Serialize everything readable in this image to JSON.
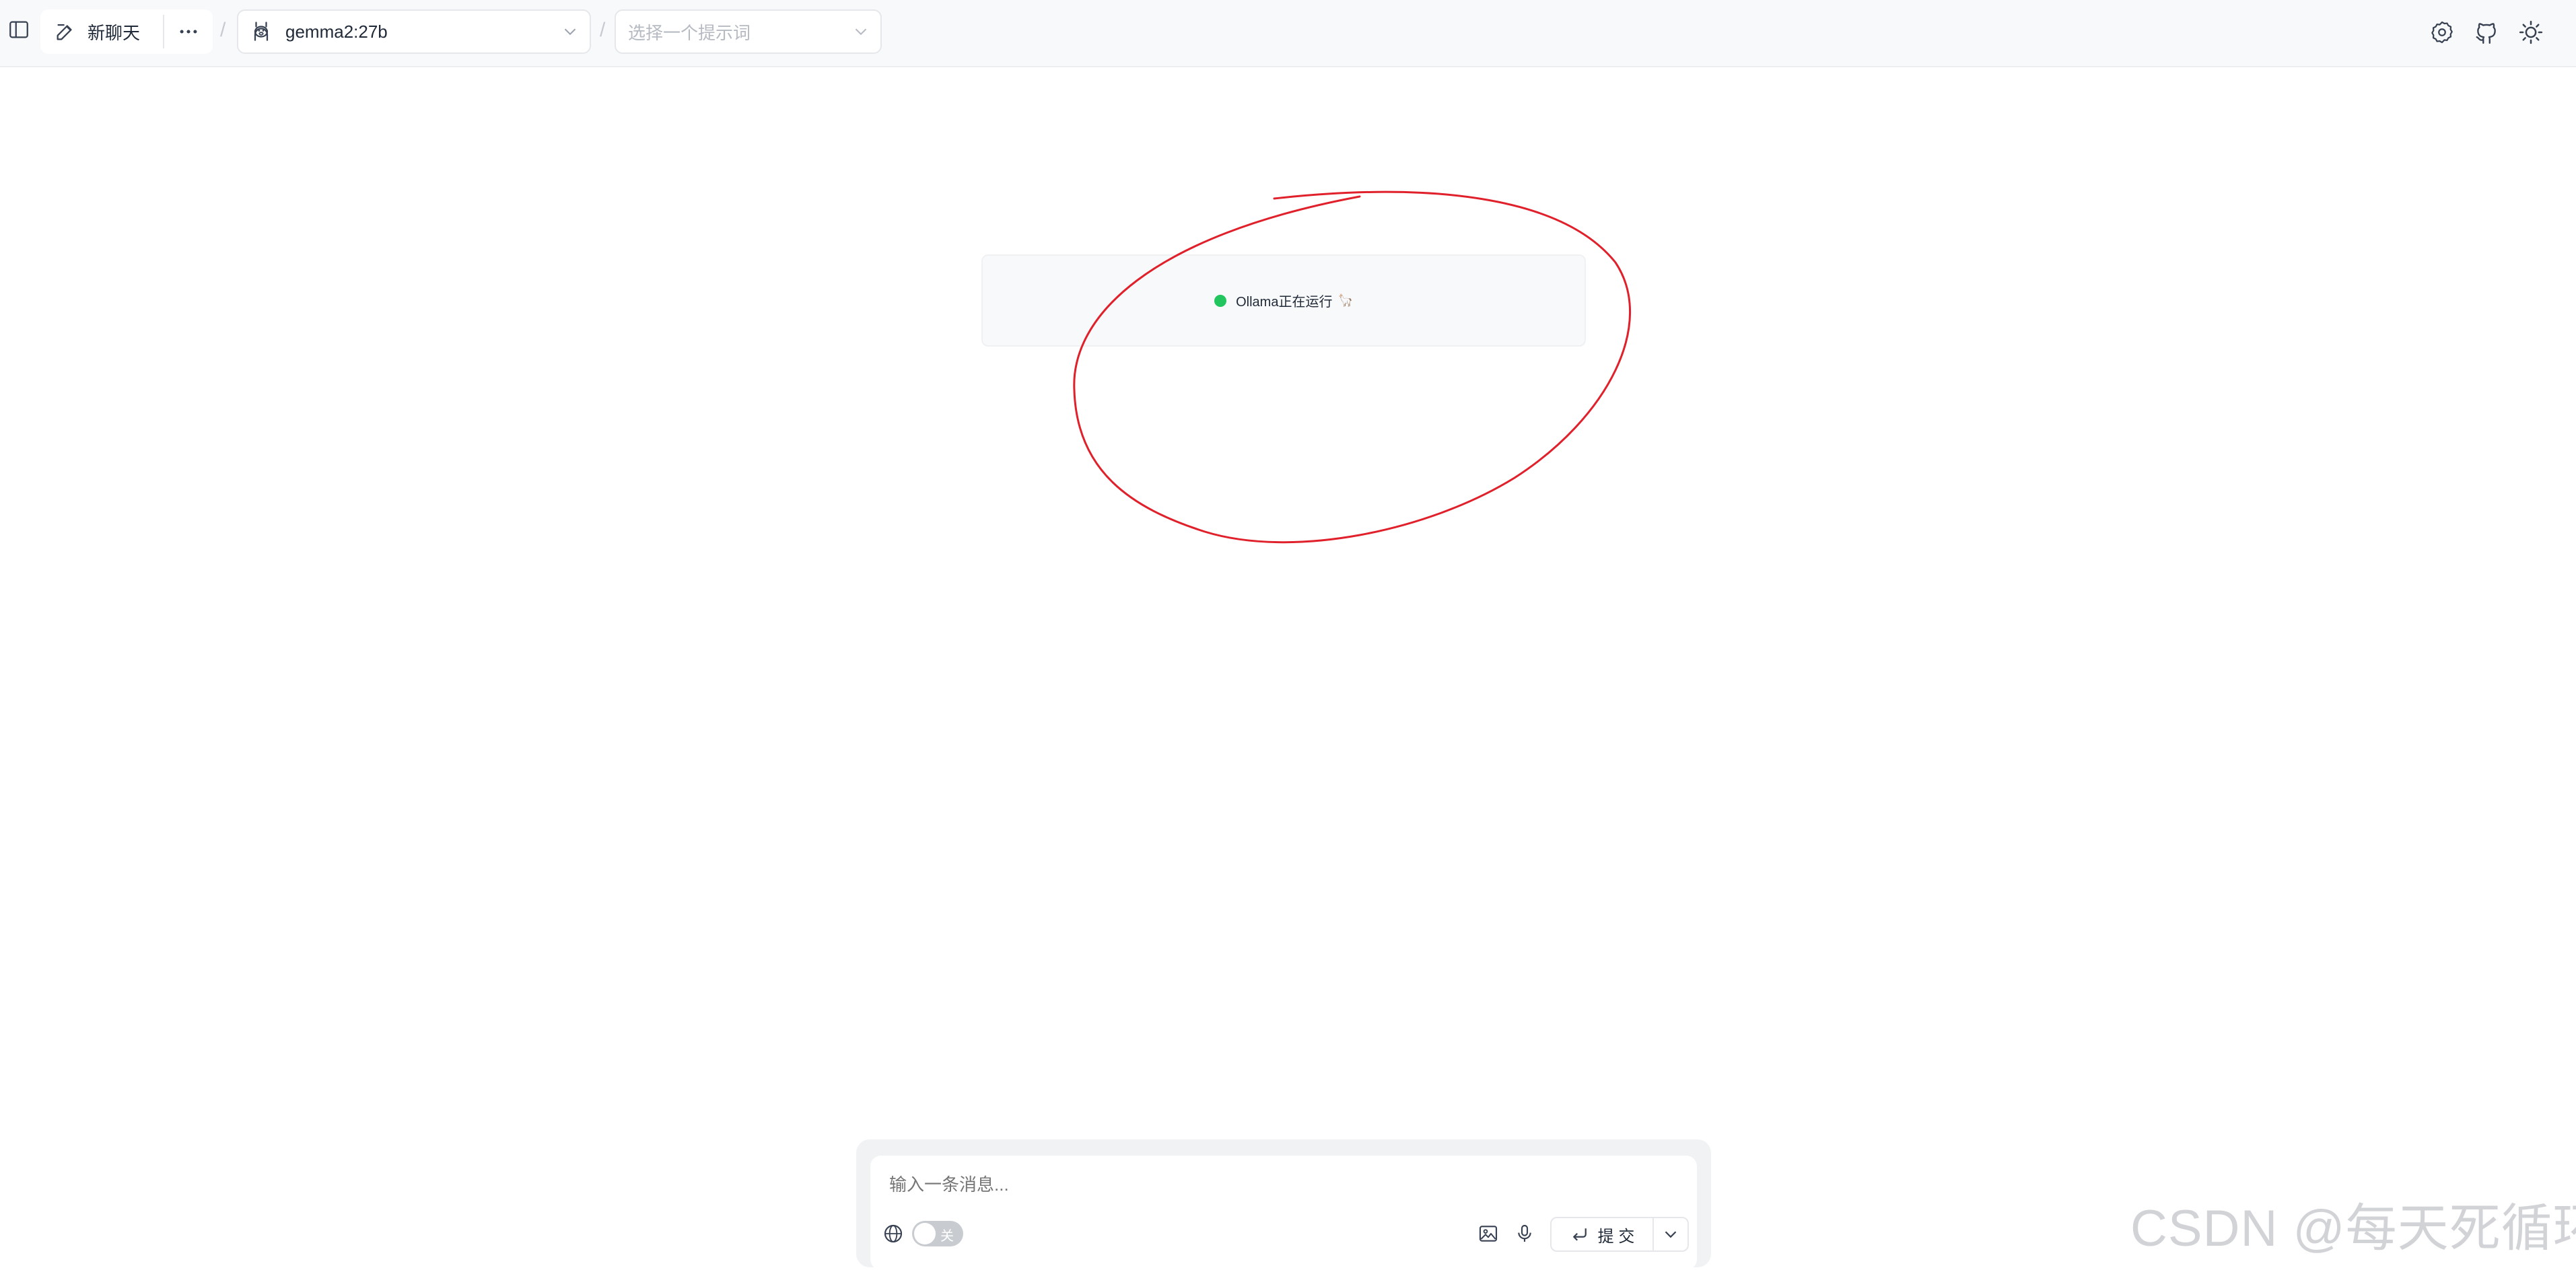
{
  "header": {
    "new_chat_label": "新聊天",
    "model_name": "gemma2:27b",
    "separator": "/",
    "prompt_placeholder": "选择一个提示词"
  },
  "icons": {
    "sidebar": "sidebar-toggle-icon",
    "new_chat": "edit-icon",
    "more": "more-icon",
    "model": "llama-icon",
    "chevron": "chevron-down-icon",
    "settings": "gear-icon",
    "github": "github-icon",
    "theme": "sun-icon",
    "globe": "globe-icon",
    "image": "image-icon",
    "mic": "microphone-icon",
    "enter": "enter-icon"
  },
  "status": {
    "text": "Ollama正在运行",
    "emoji": "🦙",
    "dot_color": "#22c55e"
  },
  "composer": {
    "placeholder": "输入一条消息...",
    "web_toggle_label": "关",
    "submit_label": "提 交"
  },
  "annotation": {
    "color": "#e0202a"
  },
  "watermark": "CSDN @每天死循环"
}
